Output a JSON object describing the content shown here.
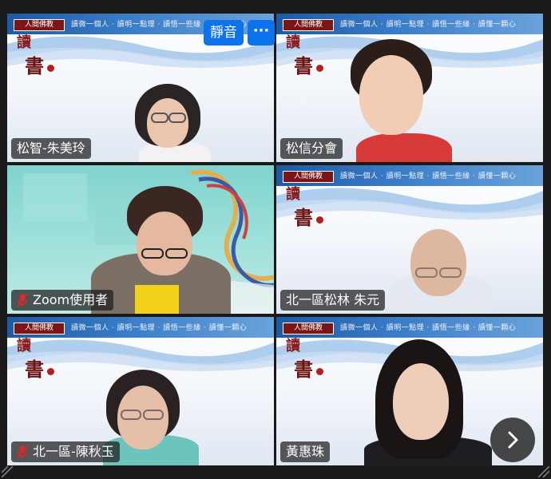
{
  "controls": {
    "mute_label": "靜音",
    "more_label": "···"
  },
  "banner": {
    "logo_text": "人間佛教",
    "slogan": "讀微一個人 · 讀明一點理 · 讀悟一些緣 · 讀懂一顆心",
    "calligraphy_top": "讀",
    "calligraphy_main": "書"
  },
  "participants": [
    {
      "name": "松智-朱美玲",
      "muted": false,
      "active": true
    },
    {
      "name": "松信分會",
      "muted": false,
      "active": false
    },
    {
      "name": "Zoom使用者",
      "muted": true,
      "active": false
    },
    {
      "name": "北一區松林 朱元",
      "muted": false,
      "active": false
    },
    {
      "name": "北一區-陳秋玉",
      "muted": true,
      "active": false
    },
    {
      "name": "黃惠珠",
      "muted": false,
      "active": false
    }
  ],
  "colors": {
    "active_border": "#3ddc84",
    "button_blue": "#0e72ed",
    "mic_off_red": "#e02828"
  },
  "icons": {
    "mic_off": "mic-off-icon",
    "next_page": "chevron-right-icon",
    "resize": "resize-corner-icon"
  }
}
